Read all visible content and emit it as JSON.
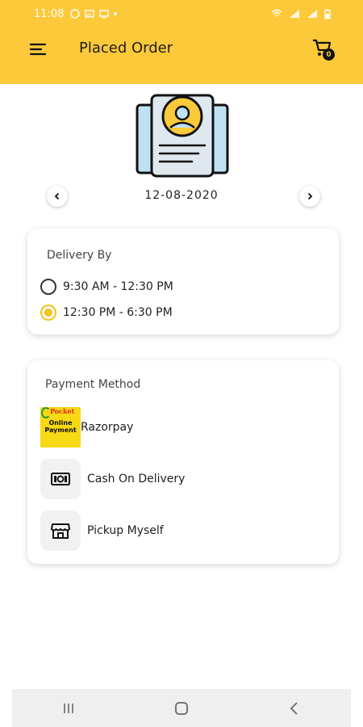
{
  "status_bar": {
    "time": "11:08"
  },
  "toolbar": {
    "title": "Placed Order",
    "cart_count": "0"
  },
  "date_picker": {
    "date": "12-08-2020"
  },
  "delivery": {
    "title": "Delivery By",
    "options": [
      {
        "label": "9:30 AM - 12:30 PM",
        "selected": false
      },
      {
        "label": "12:30 PM - 6:30 PM",
        "selected": true
      }
    ]
  },
  "payment": {
    "title": "Payment Method",
    "methods": [
      {
        "label": "Razorpay",
        "icon": "razorpay-logo",
        "logo_top": "Pocket",
        "logo_mid": "Online Payment"
      },
      {
        "label": "Cash On Delivery",
        "icon": "cash-icon"
      },
      {
        "label": "Pickup Myself",
        "icon": "store-icon"
      }
    ]
  },
  "colors": {
    "accent": "#fcc93a",
    "radio_selected": "#f5c21b"
  }
}
